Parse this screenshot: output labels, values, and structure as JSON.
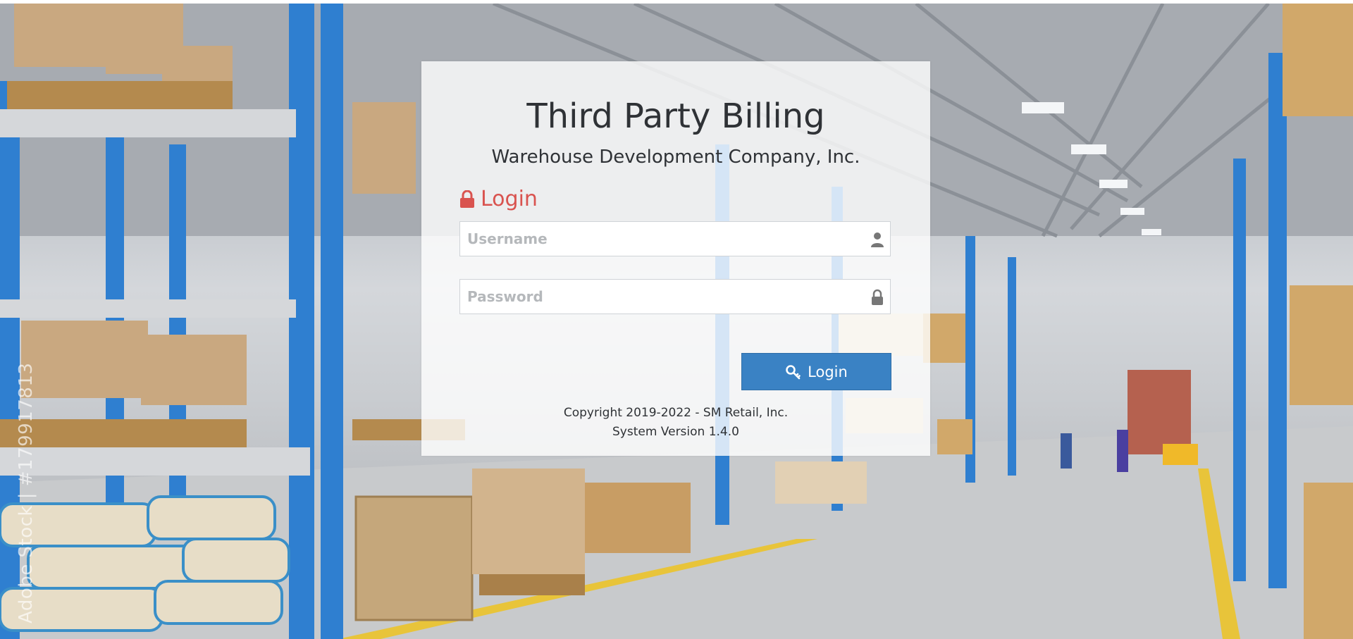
{
  "app": {
    "title": "Third Party Billing",
    "company": "Warehouse Development Company, Inc."
  },
  "login": {
    "heading": "Login",
    "username_placeholder": "Username",
    "username_value": "",
    "password_placeholder": "Password",
    "password_value": "",
    "button_label": "Login"
  },
  "footer": {
    "copyright": "Copyright 2019-2022 - SM Retail, Inc.",
    "version": "System Version 1.4.0"
  },
  "background": {
    "watermark": "Adobe Stock | #179917813"
  },
  "icons": {
    "heading": "lock-icon",
    "username": "user-icon",
    "password": "lock-icon",
    "button": "key-icon"
  },
  "colors": {
    "accent_red": "#d9534f",
    "button_blue": "#3a82c4",
    "text_dark": "#2f3236"
  }
}
